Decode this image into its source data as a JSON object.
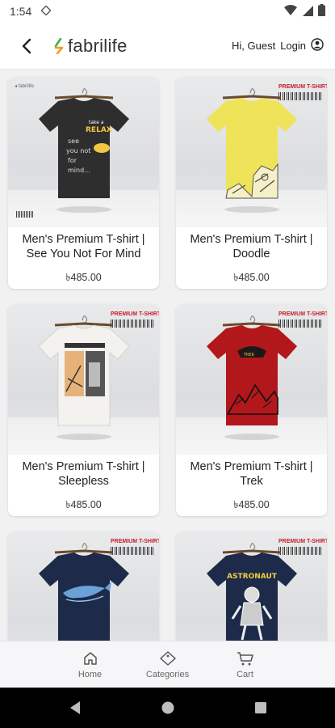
{
  "status": {
    "time": "1:54"
  },
  "header": {
    "brand": "fabrilife",
    "greeting": "Hi, Guest",
    "login_label": "Login"
  },
  "products": [
    {
      "title": "Men's Premium T-shirt | See You Not For Mind",
      "price": "৳485.00",
      "shirt_color": "#2e2e2e",
      "tag": ""
    },
    {
      "title": "Men's Premium T-shirt | Doodle",
      "price": "৳485.00",
      "shirt_color": "#efe35a",
      "tag": "PREMIUM T-SHIRT"
    },
    {
      "title": "Men's Premium T-shirt | Sleepless",
      "price": "৳485.00",
      "shirt_color": "#f3f2ef",
      "tag": "PREMIUM T-SHIRT"
    },
    {
      "title": "Men's Premium T-shirt | Trek",
      "price": "৳485.00",
      "shirt_color": "#b2171c",
      "tag": "PREMIUM T-SHIRT"
    },
    {
      "title": "",
      "price": "",
      "shirt_color": "#1e2a4a",
      "tag": "PREMIUM T-SHIRT"
    },
    {
      "title": "",
      "price": "",
      "shirt_color": "#1e2a4a",
      "tag": "PREMIUM T-SHIRT",
      "graphic_text": "ASTRONAUT"
    }
  ],
  "bottom_nav": {
    "home": "Home",
    "categories": "Categories",
    "cart": "Cart"
  },
  "colors": {
    "header_bg": "#ffffff",
    "page_bg": "#f1f1f1",
    "accent_green": "#3bb54a",
    "accent_orange": "#f39c2b"
  },
  "icons": [
    "wifi-icon",
    "signal-icon",
    "battery-icon",
    "back-arrow-icon",
    "user-circle-icon",
    "home-icon",
    "tag-icon",
    "cart-icon"
  ]
}
